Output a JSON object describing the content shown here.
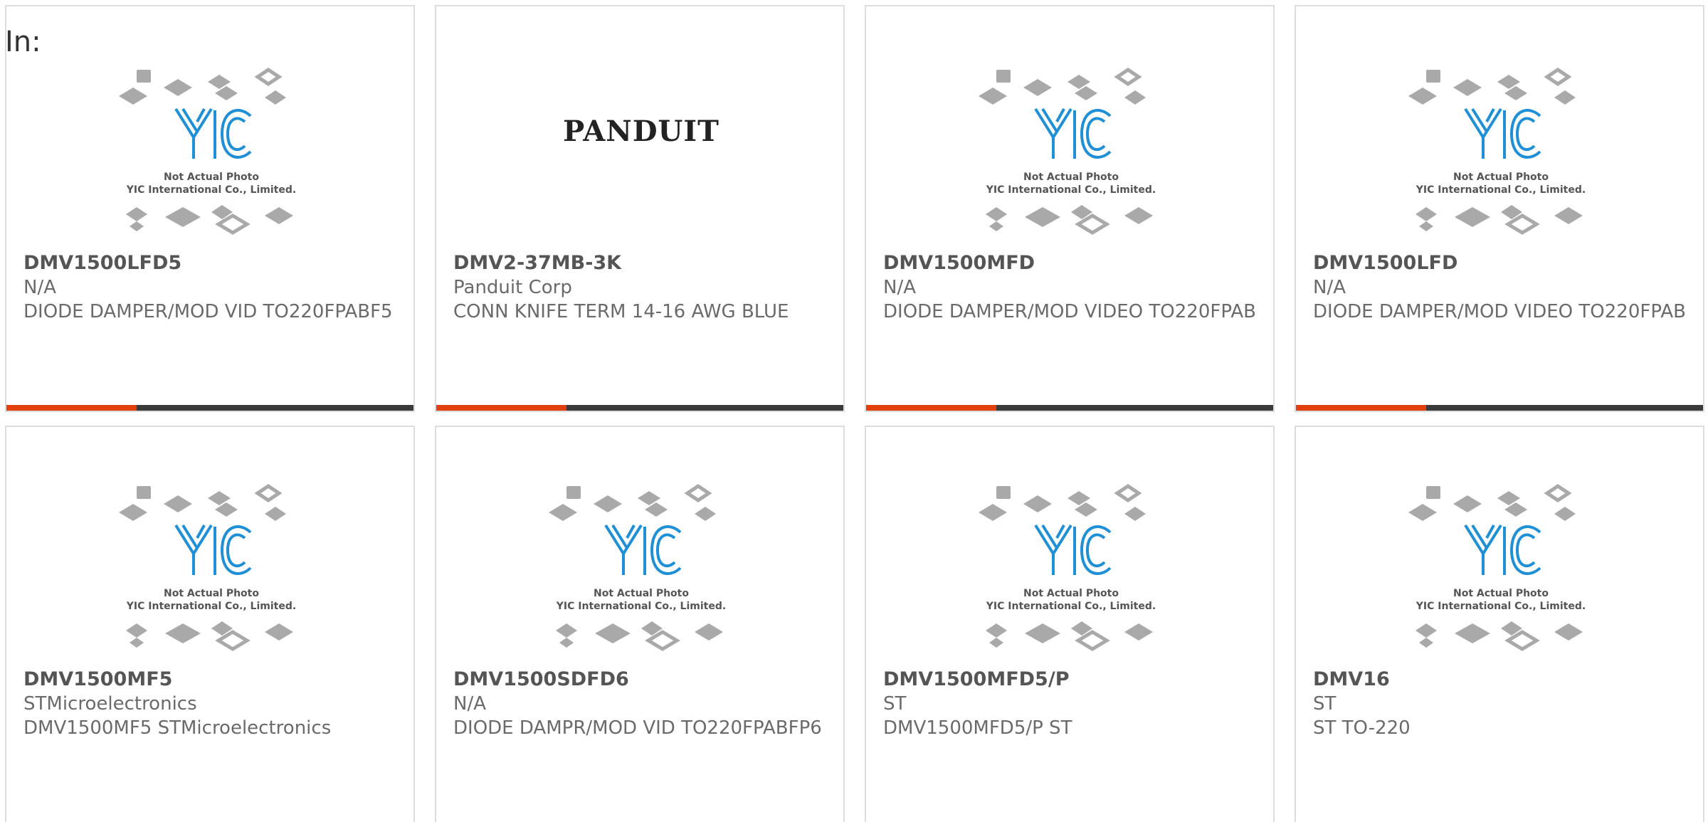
{
  "heading": "In:",
  "placeholder_caption": {
    "line1": "Not Actual Photo",
    "line2": "YIC International Co., Limited.",
    "logo_text": "YIC"
  },
  "brand_logo_text": "PANDUIT",
  "colors": {
    "accent": "#e2400f",
    "bar_dark": "#3b3b3b",
    "border": "#dddddd",
    "logo_blue": "#1f8fd6"
  },
  "products": [
    {
      "part": "DMV1500LFD5",
      "manufacturer": "N/A",
      "description": "DIODE DAMPER/MOD VID TO220FPABF5",
      "image": "placeholder-photo-icon",
      "progress_fraction": 0.32
    },
    {
      "part": "DMV2-37MB-3K",
      "manufacturer": "Panduit Corp",
      "description": "CONN KNIFE TERM 14-16 AWG BLUE",
      "image": "panduit-logo",
      "progress_fraction": 0.32
    },
    {
      "part": "DMV1500MFD",
      "manufacturer": "N/A",
      "description": "DIODE DAMPER/MOD VIDEO TO220FPAB",
      "image": "placeholder-photo-icon",
      "progress_fraction": 0.32
    },
    {
      "part": "DMV1500LFD",
      "manufacturer": "N/A",
      "description": "DIODE DAMPER/MOD VIDEO TO220FPAB",
      "image": "placeholder-photo-icon",
      "progress_fraction": 0.32
    },
    {
      "part": "DMV1500MF5",
      "manufacturer": "STMicroelectronics",
      "description": "DMV1500MF5 STMicroelectronics",
      "image": "placeholder-photo-icon"
    },
    {
      "part": "DMV1500SDFD6",
      "manufacturer": "N/A",
      "description": "DIODE DAMPR/MOD VID TO220FPABFP6",
      "image": "placeholder-photo-icon"
    },
    {
      "part": "DMV1500MFD5/P",
      "manufacturer": "ST",
      "description": "DMV1500MFD5/P ST",
      "image": "placeholder-photo-icon"
    },
    {
      "part": "DMV16",
      "manufacturer": "ST",
      "description": "ST TO-220",
      "image": "placeholder-photo-icon"
    }
  ]
}
